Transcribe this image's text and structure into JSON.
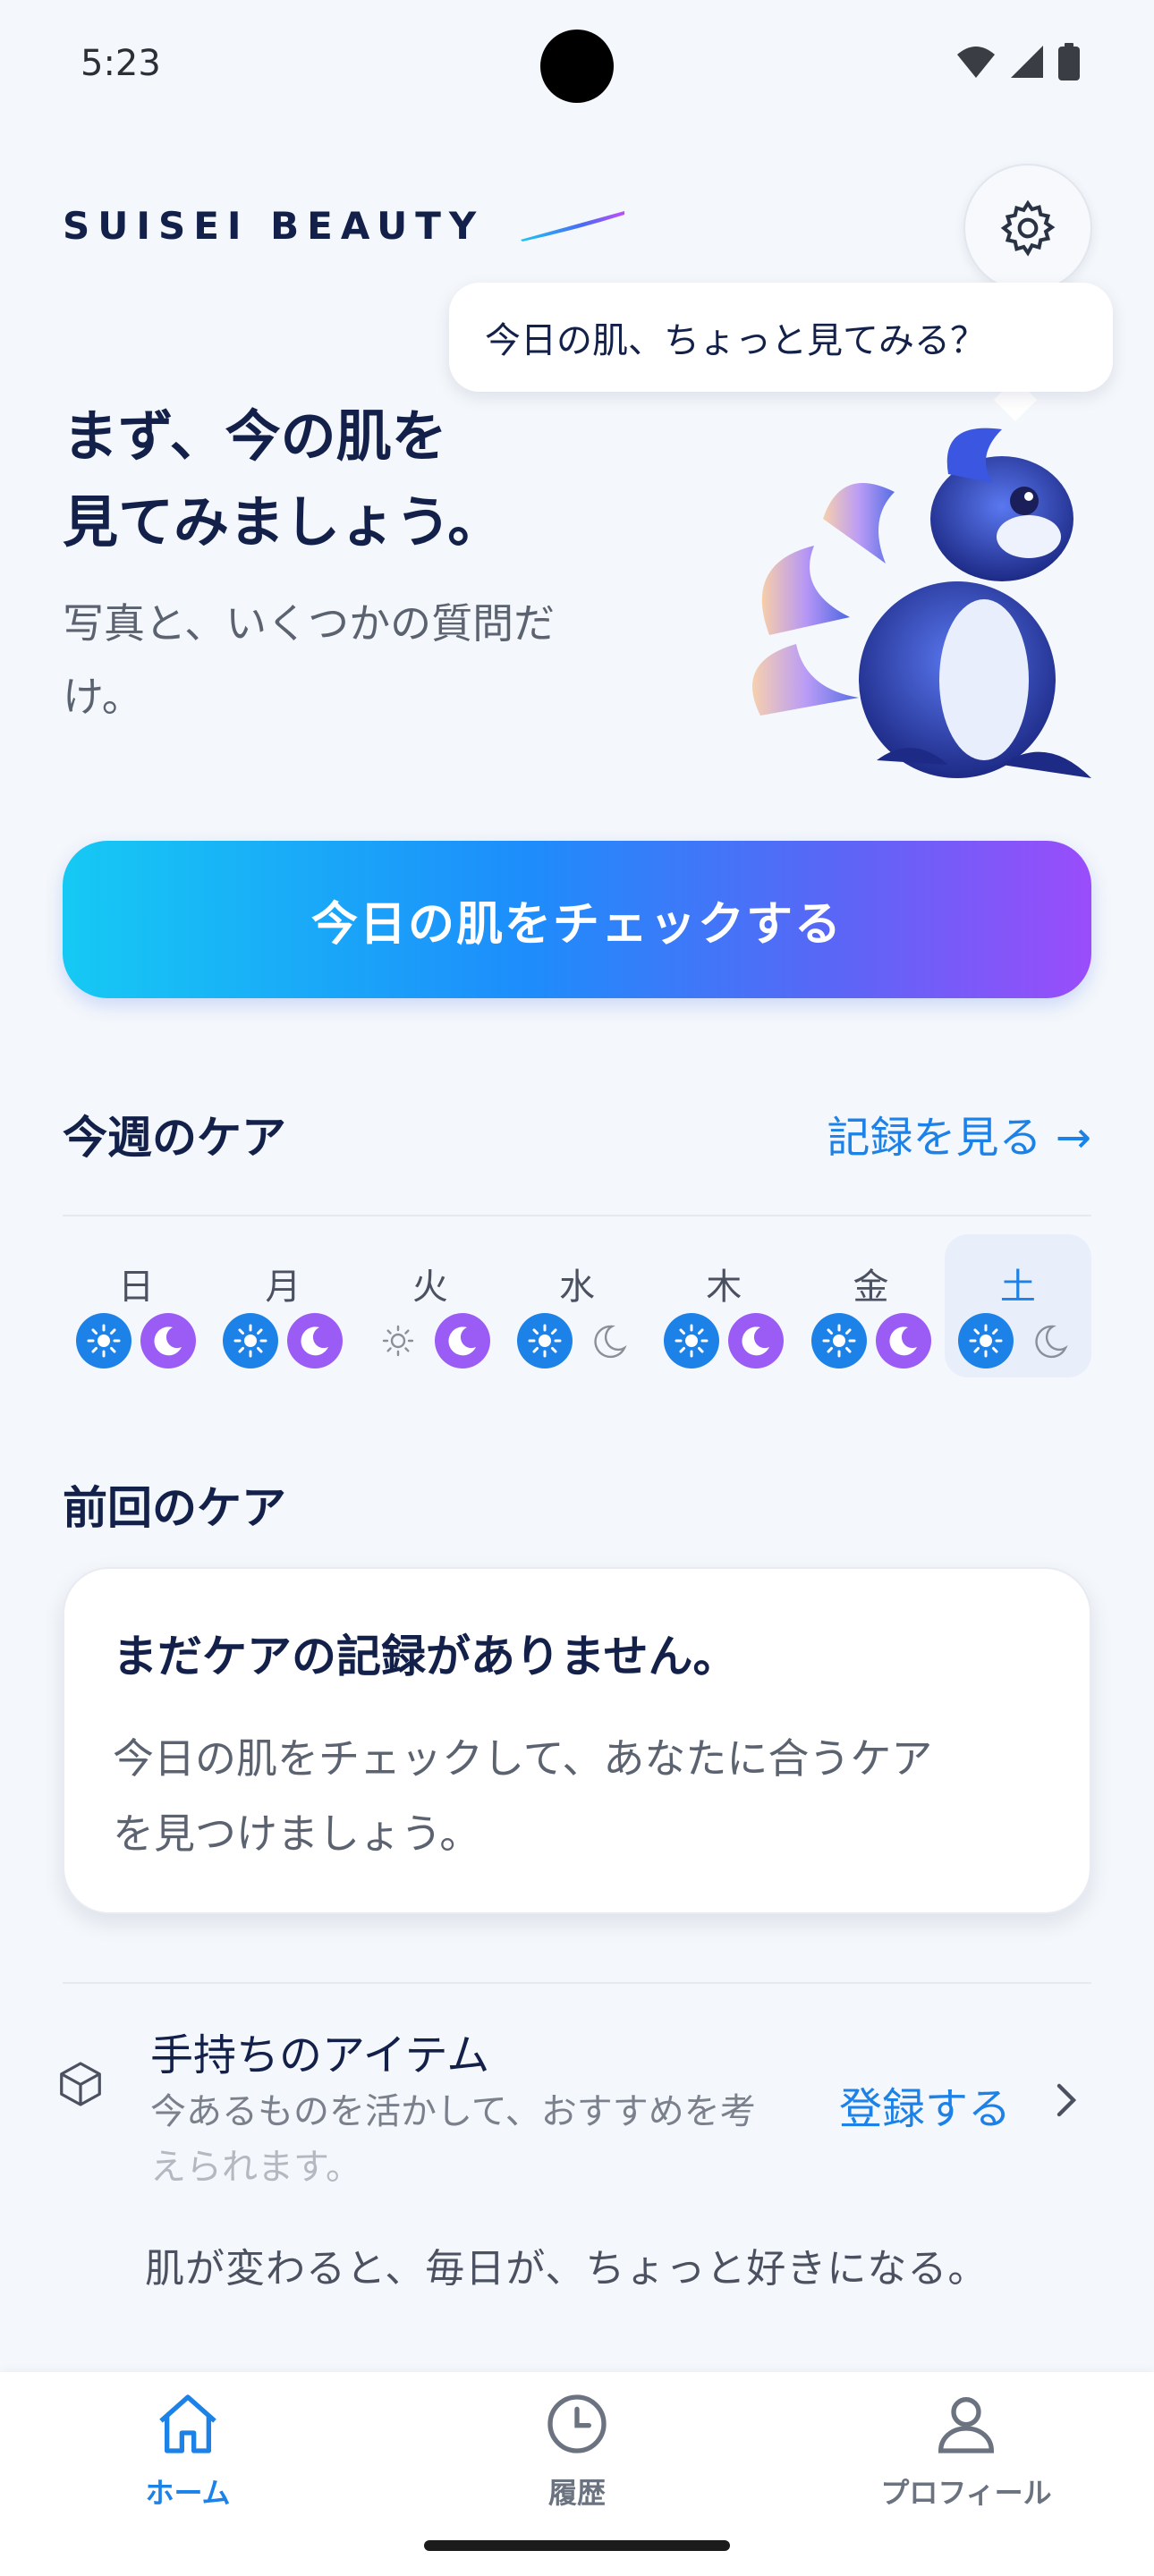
{
  "status_bar": {
    "time": "5:23"
  },
  "header": {
    "brand": "SUISEI BEAUTY"
  },
  "bubble": {
    "text": "今日の肌、ちょっと見てみる？"
  },
  "hero": {
    "title_line1": "まず、今の肌を",
    "title_line2": "見てみましょう。",
    "subtitle_line1": "写真と、いくつかの質問だ",
    "subtitle_line2": "け。"
  },
  "cta": {
    "label": "今日の肌をチェックする"
  },
  "week_care": {
    "title": "今週のケア",
    "link_label": "記録を見る →",
    "days": [
      {
        "label": "日",
        "am": "done",
        "pm": "done",
        "today": false
      },
      {
        "label": "月",
        "am": "done",
        "pm": "done",
        "today": false
      },
      {
        "label": "火",
        "am": "empty",
        "pm": "done",
        "today": false
      },
      {
        "label": "水",
        "am": "done",
        "pm": "empty",
        "today": false
      },
      {
        "label": "木",
        "am": "done",
        "pm": "done",
        "today": false
      },
      {
        "label": "金",
        "am": "done",
        "pm": "done",
        "today": false
      },
      {
        "label": "土",
        "am": "done",
        "pm": "empty",
        "today": true
      }
    ]
  },
  "last_care": {
    "title": "前回のケア",
    "card_title": "まだケアの記録がありません。",
    "card_body_line1": "今日の肌をチェックして、あなたに合うケア",
    "card_body_line2": "を見つけましょう。"
  },
  "items": {
    "title": "手持ちのアイテム",
    "sub_line1": "今あるものを活かして、おすすめを考",
    "sub_line2": "えられます。",
    "register_label": "登録する"
  },
  "tagline": "肌が変わると、毎日が、ちょっと好きになる。",
  "bottom_nav": [
    {
      "label": "ホーム",
      "icon": "home-icon",
      "active": true
    },
    {
      "label": "履歴",
      "icon": "clock-icon",
      "active": false
    },
    {
      "label": "プロフィール",
      "icon": "person-icon",
      "active": false
    }
  ],
  "colors": {
    "accent": "#1d82e8",
    "sun_done": "#1d82e8",
    "moon_done": "#9a5cf5",
    "navy": "#13214a",
    "background": "#f4f7fb"
  }
}
